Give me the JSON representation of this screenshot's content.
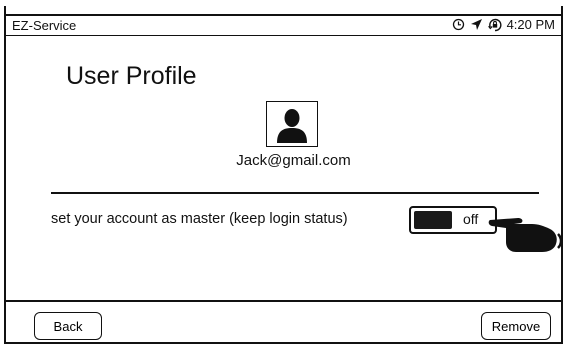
{
  "status_bar": {
    "app_name": "EZ-Service",
    "time": "4:20 PM",
    "icons": [
      "alarm-clock-icon",
      "location-arrow-icon",
      "rotation-lock-icon"
    ]
  },
  "profile": {
    "title": "User Profile",
    "avatar_icon": "user-avatar-icon",
    "email": "Jack@gmail.com"
  },
  "setting": {
    "label": "set your account as master (keep login status)",
    "toggle_state": "off",
    "toggle_on": false
  },
  "pointer_icon": "pointing-hand-icon",
  "footer": {
    "back_label": "Back",
    "remove_label": "Remove"
  },
  "colors": {
    "foreground": "#111111",
    "background": "#ffffff",
    "toggle_knob": "#1a1a1a"
  }
}
